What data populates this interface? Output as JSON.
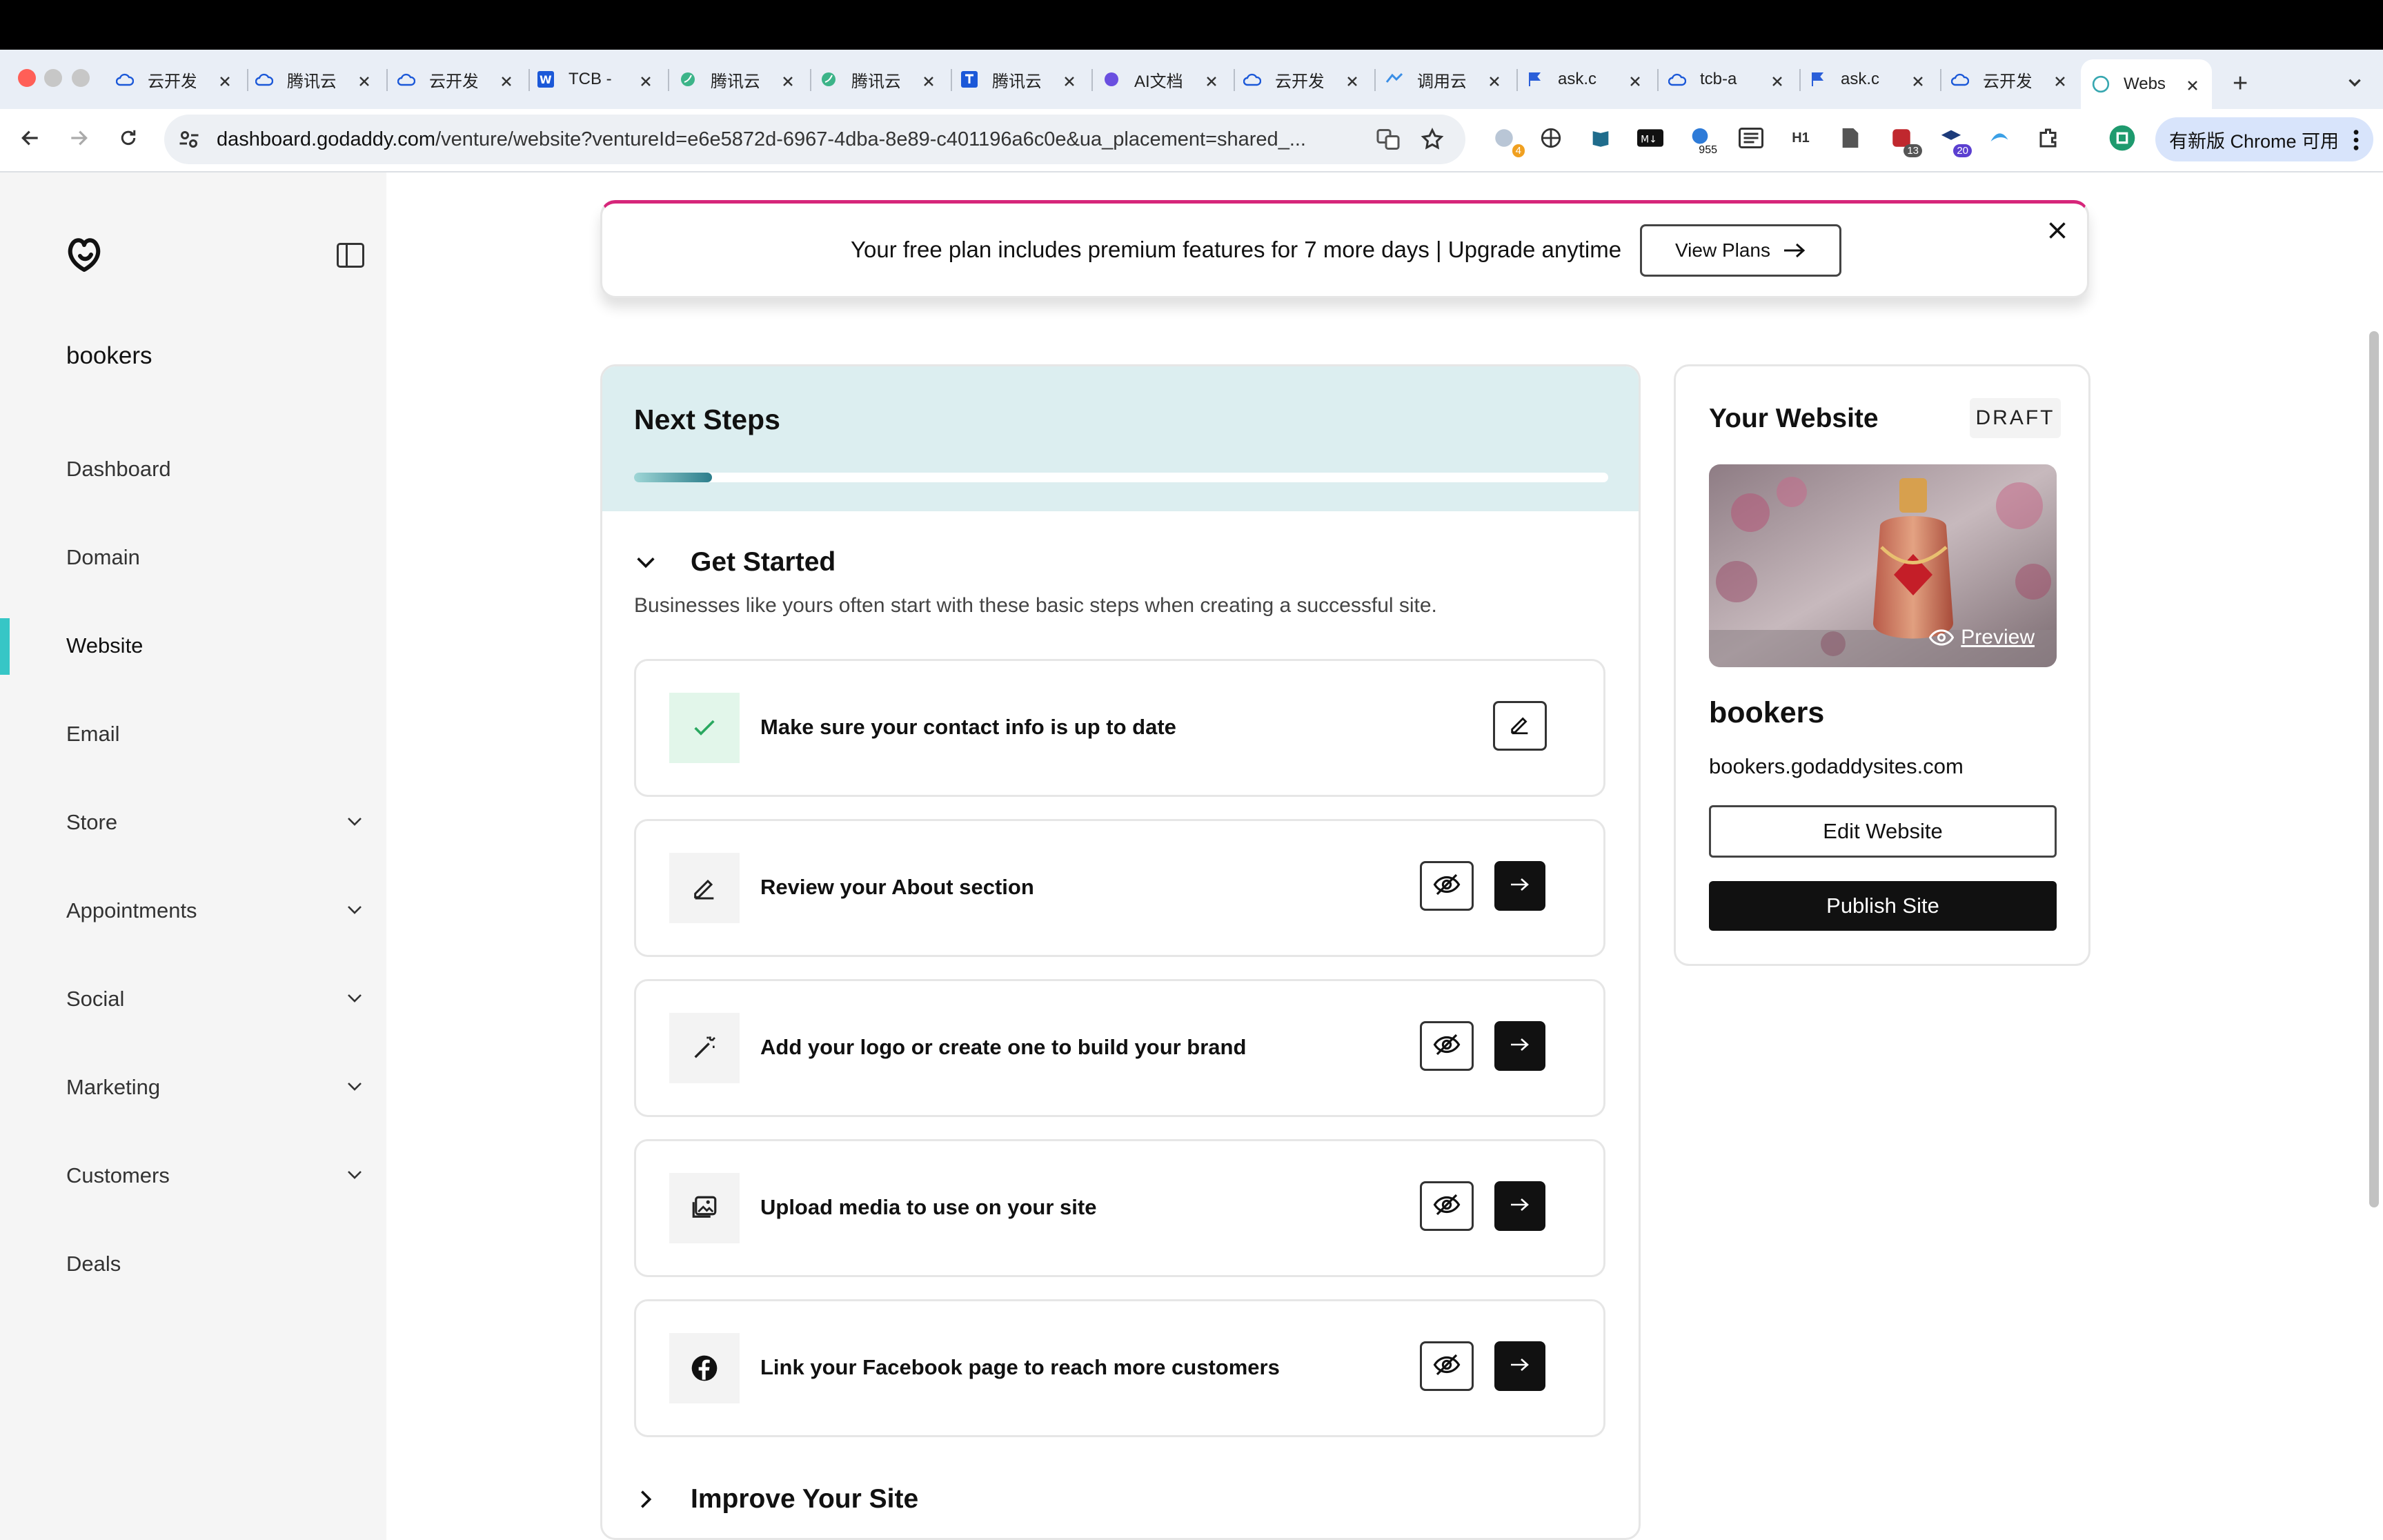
{
  "browser": {
    "tabs": [
      {
        "label": "云开发",
        "icon": "cloud-icon"
      },
      {
        "label": "腾讯云",
        "icon": "cloud-icon"
      },
      {
        "label": "云开发",
        "icon": "cloud-icon"
      },
      {
        "label": "TCB -",
        "icon": "word-icon"
      },
      {
        "label": "腾讯云",
        "icon": "leaf-icon"
      },
      {
        "label": "腾讯云",
        "icon": "leaf-icon"
      },
      {
        "label": "腾讯云",
        "icon": "doc-icon"
      },
      {
        "label": "AI文档",
        "icon": "ai-icon"
      },
      {
        "label": "云开发",
        "icon": "cloud-icon"
      },
      {
        "label": "调用云",
        "icon": "api-icon"
      },
      {
        "label": "ask.c",
        "icon": "flag-icon"
      },
      {
        "label": "tcb-a",
        "icon": "cloud-icon"
      },
      {
        "label": "ask.c",
        "icon": "flag-icon"
      },
      {
        "label": "云开发",
        "icon": "cloud-icon"
      },
      {
        "label": "Webs",
        "icon": "godaddy-icon"
      }
    ],
    "new_tab": "+",
    "url_domain": "dashboard.godaddy.com",
    "url_path": "/venture/website?ventureId=e6e5872d-6967-4dba-8e89-c401196a6c0e&ua_placement=shared_...",
    "extension_badges": {
      "first": "4",
      "count": "955",
      "h1": "H1",
      "red": "13",
      "blue": "20"
    },
    "chrome_update": "有新版 Chrome 可用"
  },
  "sidebar": {
    "brand": "bookers",
    "items": [
      {
        "label": "Dashboard",
        "expandable": false
      },
      {
        "label": "Domain",
        "expandable": false
      },
      {
        "label": "Website",
        "expandable": false,
        "active": true
      },
      {
        "label": "Email",
        "expandable": false
      },
      {
        "label": "Store",
        "expandable": true
      },
      {
        "label": "Appointments",
        "expandable": true
      },
      {
        "label": "Social",
        "expandable": true
      },
      {
        "label": "Marketing",
        "expandable": true
      },
      {
        "label": "Customers",
        "expandable": true
      },
      {
        "label": "Deals",
        "expandable": false
      }
    ]
  },
  "banner": {
    "text": "Your free plan includes premium features for 7 more days  |  Upgrade anytime",
    "button": "View Plans"
  },
  "next_steps": {
    "title": "Next Steps",
    "progress": 0.08,
    "section_title": "Get Started",
    "section_desc": "Businesses like yours often start with these basic steps when creating a successful site.",
    "steps": [
      {
        "label": "Make sure your contact info is up to date",
        "icon": "check-icon",
        "done": true
      },
      {
        "label": "Review your About section",
        "icon": "pencil-icon",
        "done": false
      },
      {
        "label": "Add your logo or create one to build your brand",
        "icon": "magic-wand-icon",
        "done": false
      },
      {
        "label": "Upload media to use on your site",
        "icon": "image-icon",
        "done": false
      },
      {
        "label": "Link your Facebook page to reach more customers",
        "icon": "facebook-icon",
        "done": false
      }
    ],
    "next_section_title": "Improve Your Site"
  },
  "website_card": {
    "title": "Your Website",
    "status": "DRAFT",
    "preview": "Preview",
    "site_name": "bookers",
    "domain": "bookers.godaddysites.com",
    "edit_button": "Edit Website",
    "publish_button": "Publish Site"
  },
  "colors": {
    "accent": "#37c6c6",
    "banner_border": "#d6267a",
    "header_bg": "#dceef0",
    "button_dark": "#111111"
  }
}
